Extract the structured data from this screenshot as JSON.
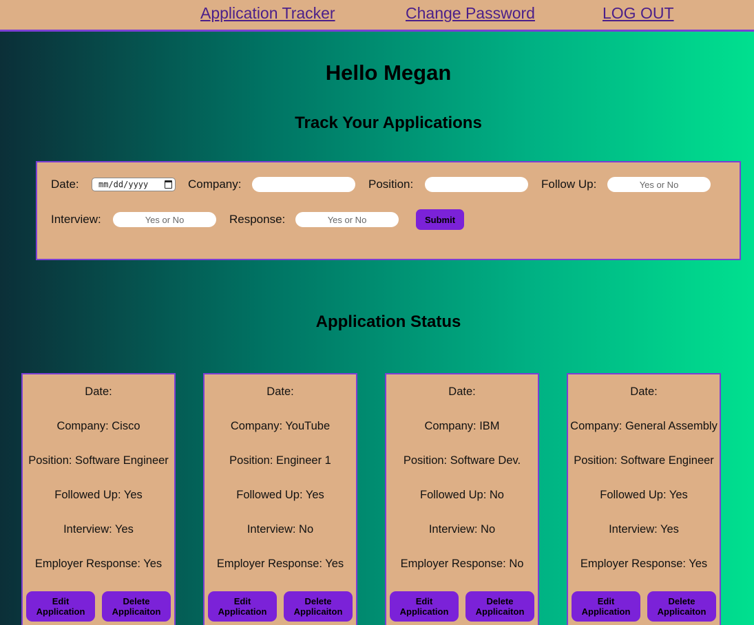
{
  "nav": {
    "tracker": "Application Tracker",
    "change_password": "Change Password",
    "logout": "LOG OUT"
  },
  "greeting": "Hello Megan",
  "subtitle": "Track Your Applications",
  "form": {
    "date_label": "Date:",
    "date_value": "mm/dd/yyyy",
    "company_label": "Company:",
    "company_value": "",
    "position_label": "Position:",
    "position_value": "",
    "followup_label": "Follow Up:",
    "followup_placeholder": "Yes or No",
    "interview_label": "Interview:",
    "interview_placeholder": "Yes or No",
    "response_label": "Response:",
    "response_placeholder": "Yes or No",
    "submit_label": "Submit"
  },
  "status_title": "Application Status",
  "cards": [
    {
      "date": "Date:",
      "company": "Company: Cisco",
      "position": "Position: Software Engineer",
      "followed_up": "Followed Up: Yes",
      "interview": "Interview: Yes",
      "response": "Employer Response: Yes",
      "edit_label": "Edit Application",
      "delete_label": "Delete Applicaiton"
    },
    {
      "date": "Date:",
      "company": "Company: YouTube",
      "position": "Position: Engineer 1",
      "followed_up": "Followed Up: Yes",
      "interview": "Interview: No",
      "response": "Employer Response: Yes",
      "edit_label": "Edit Application",
      "delete_label": "Delete Applicaiton"
    },
    {
      "date": "Date:",
      "company": "Company: IBM",
      "position": "Position: Software Dev.",
      "followed_up": "Followed Up: No",
      "interview": "Interview: No",
      "response": "Employer Response: No",
      "edit_label": "Edit Application",
      "delete_label": "Delete Applicaiton"
    },
    {
      "date": "Date:",
      "company": "Company: General Assembly",
      "position": "Position: Software Engineer",
      "followed_up": "Followed Up: Yes",
      "interview": "Interview: Yes",
      "response": "Employer Response: Yes",
      "edit_label": "Edit Application",
      "delete_label": "Delete Applicaiton"
    }
  ],
  "colors": {
    "panel": "#ddaf86",
    "accent": "#7b22d8",
    "border": "#7b3fd3",
    "link": "#4a1f8a"
  }
}
